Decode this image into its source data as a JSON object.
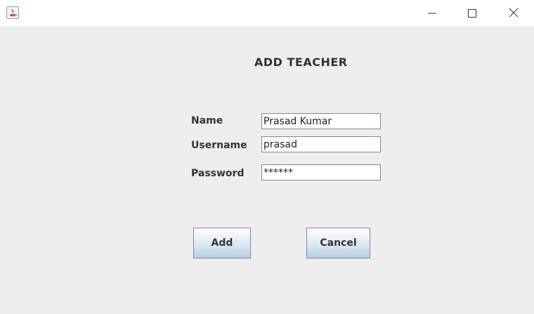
{
  "window": {
    "controls": {
      "minimize_icon": "minimize-icon",
      "maximize_icon": "maximize-icon",
      "close_icon": "close-icon"
    },
    "app_icon": "java-icon"
  },
  "form": {
    "heading": "ADD TEACHER",
    "name_label": "Name",
    "name_value": "Prasad Kumar",
    "username_label": "Username",
    "username_value": "prasad",
    "password_label": "Password",
    "password_value": "******"
  },
  "buttons": {
    "add_label": "Add",
    "cancel_label": "Cancel"
  },
  "colors": {
    "background": "#eeeeee",
    "titlebar": "#ffffff",
    "text": "#333333",
    "button_gradient_end": "#b8cfe5"
  }
}
